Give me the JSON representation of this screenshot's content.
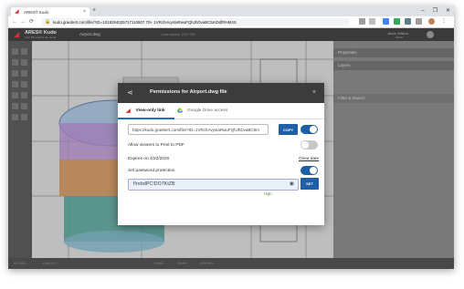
{
  "browser": {
    "tab_title": "ARES® Kudo",
    "tab_close": "×",
    "new_tab": "+",
    "url": "kudo.graebert.com/file/?ID=1018284025717110807 70+ 1VRchAvysIaRwuFQhJhDvaBC5mDdfRHM4S",
    "window_controls": [
      "–",
      "❐",
      "✕"
    ],
    "nav": [
      "←",
      "→",
      "⟳"
    ]
  },
  "app": {
    "logo": "ARES® Kudo",
    "logo_sub": "Your 3D CAD in the cloud",
    "file_name": "Airport.dwg",
    "last_saved": "Last saved: 2:07 PM",
    "user_name": "Anne Wilson",
    "user_label": "Anne"
  },
  "panels": {
    "properties": "Properties",
    "layers": "Layers",
    "filter": "Filter & Search"
  },
  "status": [
    "MODEL",
    "LAYOUT",
    "GRID",
    "SNAP",
    "ORTHO"
  ],
  "dialog": {
    "title": "Permissions for Airport.dwg file",
    "close": "×",
    "tabs": [
      {
        "label": "View-only link",
        "active": true
      },
      {
        "label": "Google Drive access",
        "active": false
      }
    ],
    "link_value": "https://kudo.graebert.com/file/?ID=1VRchAvysIaRwuFQhJhDvaBC5m",
    "copy_label": "COPY",
    "link_enabled": true,
    "print_label": "Allow viewers to Print to PDF",
    "print_enabled": false,
    "expires_label": "Expires on 4/22/2020",
    "clear_date": "Clear date",
    "password_label": "Set password protection",
    "password_enabled": true,
    "password_value": "f!rebdPC!DO7KtZB",
    "set_label": "SET",
    "strength": "High"
  },
  "colors": {
    "accent": "#1e5fa8",
    "header": "#3c3c3c",
    "strength": "#4a9b2a",
    "brand": "#d32f2f"
  }
}
